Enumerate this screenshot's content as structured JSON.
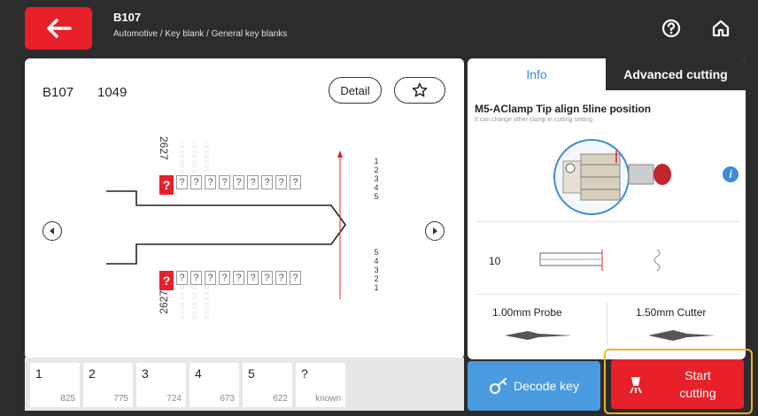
{
  "header": {
    "title": "B107",
    "breadcrumb": "Automotive / Key blank / General key blanks"
  },
  "key": {
    "id": "B107",
    "code": "1049",
    "detail_label": "Detail",
    "top_number": "2627",
    "bottom_number": "2627",
    "question_mark": "?",
    "cut_numbers_top": [
      "1",
      "2",
      "3",
      "4",
      "5"
    ],
    "cut_numbers_bottom": [
      "5",
      "4",
      "3",
      "2",
      "1"
    ]
  },
  "tabs_bottom": [
    {
      "n": "1",
      "v": "825"
    },
    {
      "n": "2",
      "v": "775"
    },
    {
      "n": "3",
      "v": "724"
    },
    {
      "n": "4",
      "v": "673"
    },
    {
      "n": "5",
      "v": "622"
    },
    {
      "n": "?",
      "v": "known"
    }
  ],
  "right": {
    "tab_info": "Info",
    "tab_advanced": "Advanced cutting",
    "clamp_title": "M5-AClamp Tip align 5line position",
    "clamp_subtitle": "It can change other clamp in cutting setting",
    "depth_value": "10",
    "probe": "1.00mm Probe",
    "cutter": "1.50mm Cutter"
  },
  "actions": {
    "decode": "Decode key",
    "start_line1": "Start",
    "start_line2": "cutting"
  },
  "colors": {
    "accent_red": "#e8202a",
    "accent_blue": "#4a9ae0",
    "highlight": "#f0b429"
  }
}
